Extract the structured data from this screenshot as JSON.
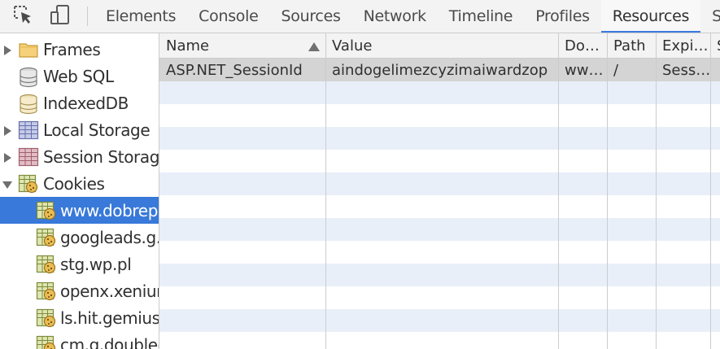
{
  "toolbar": {
    "inspect_icon": "inspect-element-icon",
    "device_icon": "device-mode-icon",
    "tabs": [
      {
        "label": "Elements",
        "active": false
      },
      {
        "label": "Console",
        "active": false
      },
      {
        "label": "Sources",
        "active": false
      },
      {
        "label": "Network",
        "active": false
      },
      {
        "label": "Timeline",
        "active": false
      },
      {
        "label": "Profiles",
        "active": false
      },
      {
        "label": "Resources",
        "active": true
      },
      {
        "label": "S",
        "active": false
      }
    ]
  },
  "sidebar": {
    "items": [
      {
        "label": "Frames",
        "icon": "folder-icon",
        "expander": "collapsed"
      },
      {
        "label": "Web SQL",
        "icon": "database-icon",
        "expander": "none"
      },
      {
        "label": "IndexedDB",
        "icon": "database-icon",
        "expander": "none"
      },
      {
        "label": "Local Storage",
        "icon": "storage-grid-icon",
        "expander": "collapsed"
      },
      {
        "label": "Session Storage",
        "icon": "storage-grid-icon",
        "expander": "collapsed"
      },
      {
        "label": "Cookies",
        "icon": "cookie-icon",
        "expander": "expanded"
      },
      {
        "label": "www.dobrepr",
        "icon": "cookie-icon",
        "selected": true
      },
      {
        "label": "googleads.g.d",
        "icon": "cookie-icon"
      },
      {
        "label": "stg.wp.pl",
        "icon": "cookie-icon"
      },
      {
        "label": "openx.xenium",
        "icon": "cookie-icon"
      },
      {
        "label": "ls.hit.gemius.p",
        "icon": "cookie-icon"
      },
      {
        "label": "cm.g.doublecl",
        "icon": "cookie-icon"
      }
    ]
  },
  "grid": {
    "columns": [
      "Name",
      "Value",
      "Do…",
      "Path",
      "Expi…",
      "S"
    ],
    "rows": [
      [
        "ASP.NET_SessionId",
        "aindogelimezcyzimaiwardzop",
        "ww…",
        "/",
        "Sess…",
        ""
      ]
    ]
  },
  "colors": {
    "selection_blue": "#3879d9",
    "active_tab_underline": "#3b7be0",
    "stripe": "#e9eff9",
    "selected_row": "#d4d4d4"
  }
}
